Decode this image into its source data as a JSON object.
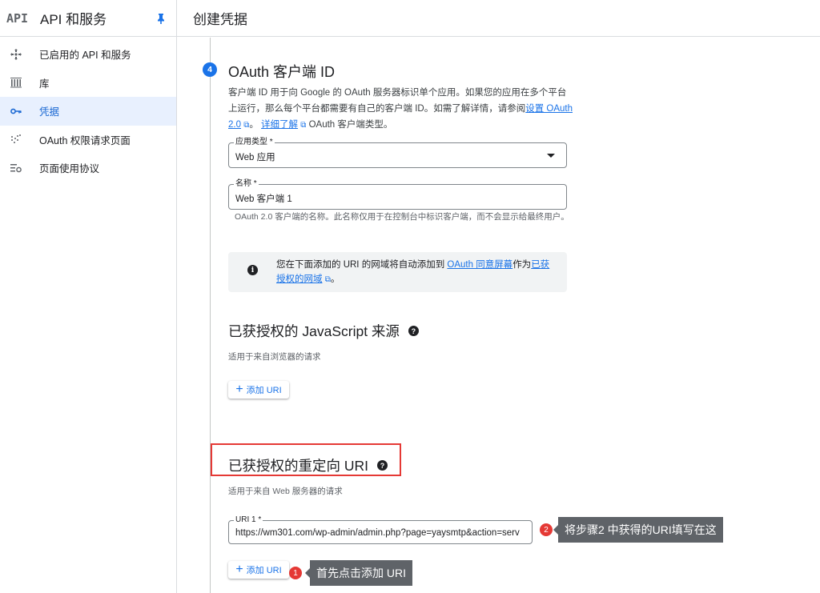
{
  "sidebar": {
    "logo": "API",
    "title": "API 和服务",
    "items": [
      {
        "label": "已启用的 API 和服务",
        "icon": "enabled-apis-icon"
      },
      {
        "label": "库",
        "icon": "library-icon"
      },
      {
        "label": "凭据",
        "icon": "key-icon",
        "active": true
      },
      {
        "label": "OAuth 权限请求页面",
        "icon": "consent-screen-icon"
      },
      {
        "label": "页面使用协议",
        "icon": "page-agreement-icon"
      }
    ]
  },
  "header": {
    "title": "创建凭据"
  },
  "step": {
    "number": "4",
    "title": "OAuth 客户端 ID",
    "desc_part1": "客户端 ID 用于向 Google 的 OAuth 服务器标识单个应用。如果您的应用在多个平台上运行，那么每个平台都需要有自己的客户端 ID。如需了解详情，请参阅",
    "desc_link1": "设置 OAuth 2.0",
    "desc_part2": "。",
    "desc_link2": "详细了解",
    "desc_part3": " OAuth 客户端类型。"
  },
  "app_type": {
    "label": "应用类型 *",
    "value": "Web 应用"
  },
  "name_field": {
    "label": "名称 *",
    "value": "Web 客户端 1",
    "helper": "OAuth 2.0 客户端的名称。此名称仅用于在控制台中标识客户端，而不会显示给最终用户。"
  },
  "info": {
    "text_part1": "您在下面添加的 URI 的网域将自动添加到 ",
    "link1": "OAuth 同意屏幕",
    "text_part2": "作为",
    "link2": "已获授权的网域",
    "text_part3": "。"
  },
  "js_origins": {
    "title": "已获授权的 JavaScript 来源",
    "subtitle": "适用于来自浏览器的请求",
    "add_label": "添加 URI"
  },
  "redirect_uris": {
    "title": "已获授权的重定向 URI",
    "subtitle": "适用于来自 Web 服务器的请求",
    "uri_label": "URI 1 *",
    "uri_value": "https://wm301.com/wp-admin/admin.php?page=yaysmtp&action=serv",
    "add_label": "添加 URI"
  },
  "annotations": [
    {
      "num": "1",
      "text": "首先点击添加 URI"
    },
    {
      "num": "2",
      "text": "将步骤2 中获得的URI填写在这"
    }
  ],
  "colors": {
    "accent": "#1a73e8",
    "highlight": "#e53935",
    "callout_bg": "#5f6368"
  }
}
